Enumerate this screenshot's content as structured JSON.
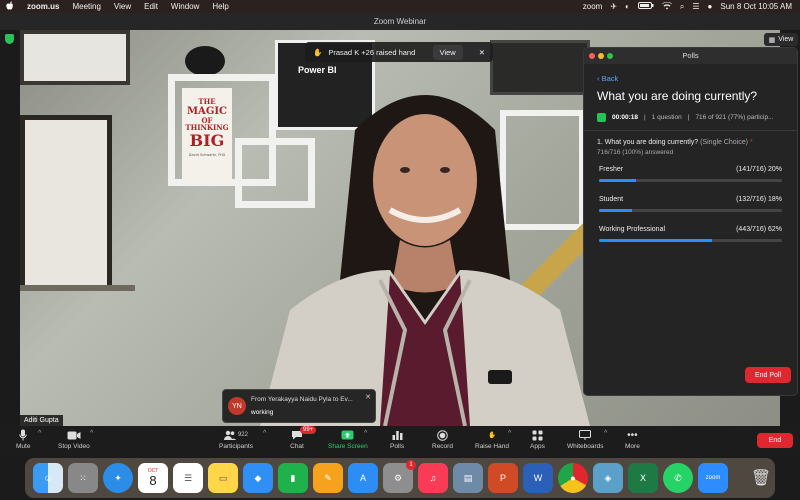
{
  "menubar": {
    "app": "zoom.us",
    "items": [
      "Meeting",
      "View",
      "Edit",
      "Window",
      "Help"
    ],
    "status_app": "zoom",
    "datetime": "Sun 8 Oct  10:05 AM"
  },
  "window": {
    "title": "Zoom Webinar"
  },
  "raised_hand": {
    "text": "Prasad K +26 raised hand",
    "view_label": "View",
    "close": "✕"
  },
  "view_button": {
    "label": "View"
  },
  "video": {
    "participant_name": "Aditi Gupta",
    "book_title": [
      "THE",
      "MAGIC",
      "OF",
      "THINKING",
      "BIG"
    ],
    "book_author": "David Schwartz, PhD",
    "poster_text": "Power BI"
  },
  "poll": {
    "window_title": "Polls",
    "back": "Back",
    "title": "What you are doing currently?",
    "timer": "00:00:18",
    "questions": "1 question",
    "participation": "716 of 921 (77%) particip...",
    "question": "1. What you are doing currently?",
    "question_type": "(Single Choice)",
    "required": "*",
    "answered": "716/716 (100%) answered",
    "options": [
      {
        "label": "Fresher",
        "stat": "(141/716) 20%",
        "fraction": 0.2
      },
      {
        "label": "Student",
        "stat": "(132/716) 18%",
        "fraction": 0.18
      },
      {
        "label": "Working Professional",
        "stat": "(443/716) 62%",
        "fraction": 0.62
      }
    ],
    "end_label": "End Poll"
  },
  "chat_popup": {
    "initials": "YN",
    "from": "From Yerakayya Naidu Pyla to Ev...",
    "message": "working",
    "close": "✕"
  },
  "toolbar": {
    "mute": "Mute",
    "stop_video": "Stop Video",
    "participants": "Participants",
    "participants_count": "922",
    "chat": "Chat",
    "chat_badge": "99+",
    "share_screen": "Share Screen",
    "polls": "Polls",
    "record": "Record",
    "raise_hand": "Raise Hand",
    "apps": "Apps",
    "whiteboards": "Whiteboards",
    "more": "More",
    "end": "End"
  },
  "dock": {
    "calendar_month": "OCT",
    "calendar_day": "8",
    "settings_badge": "1",
    "zoom_label": "zoom"
  },
  "colors": {
    "accent_blue": "#2d8cff",
    "end_red": "#e0262e",
    "share_green": "#2ecc71"
  }
}
